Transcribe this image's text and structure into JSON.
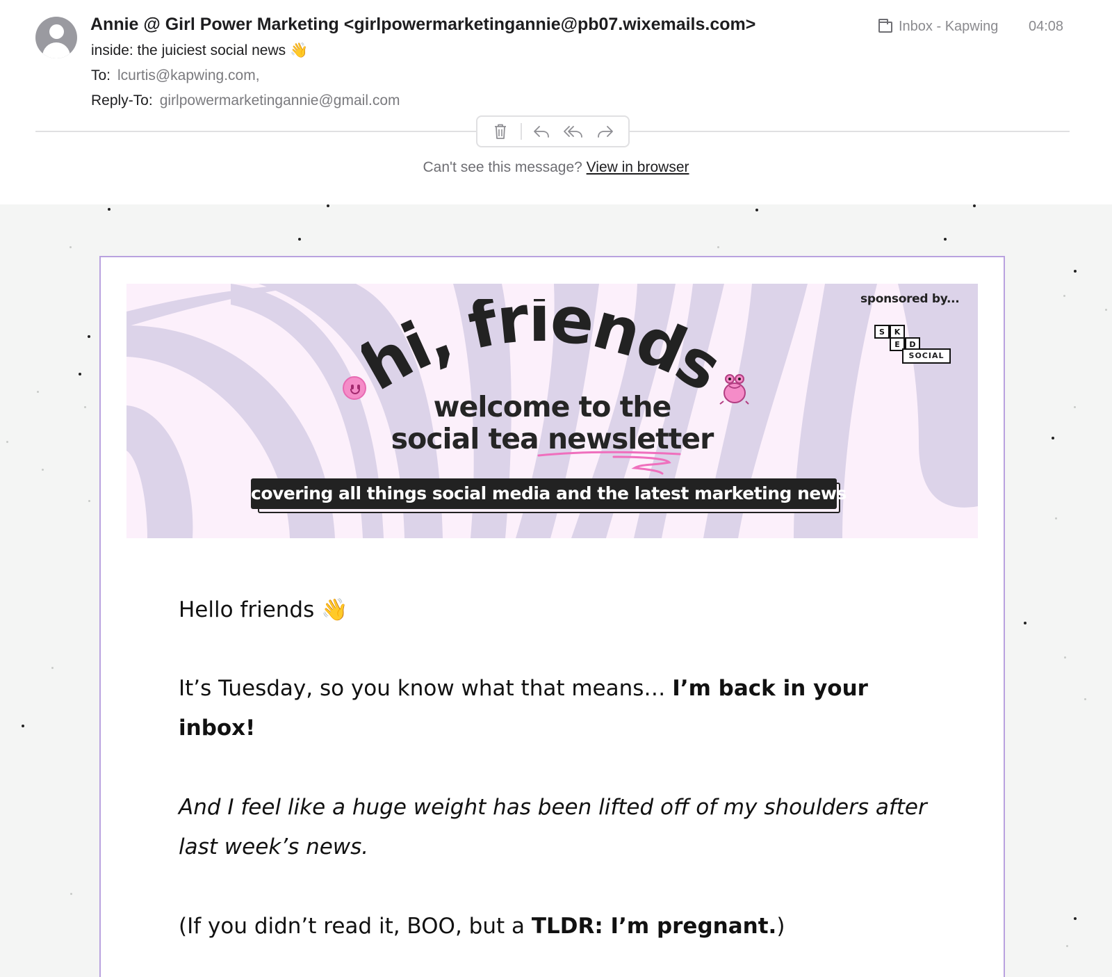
{
  "header": {
    "sender": "Annie @ Girl Power Marketing <girlpowermarketingannie@pb07.wixemails.com>",
    "subject": "inside: the juiciest social news 👋",
    "to_label": "To:",
    "to_value": "lcurtis@kapwing.com,",
    "replyto_label": "Reply-To:",
    "replyto_value": "girlpowermarketingannie@gmail.com",
    "mailbox": "Inbox - Kapwing",
    "time": "04:08"
  },
  "toolbar": {
    "icons": [
      "trash-icon",
      "reply-icon",
      "reply-all-icon",
      "forward-icon"
    ]
  },
  "preview": {
    "prompt": "Can't see this message?",
    "link": "View in browser"
  },
  "banner": {
    "headline": "hi, friends",
    "welcome_line1": "welcome to the",
    "welcome_line2_a": "social tea ",
    "welcome_line2_b": "newsletter",
    "tagline": "covering all things social media and the latest marketing news",
    "sponsored": "sponsored by...",
    "sponsor_letters": [
      "S",
      "K",
      "E",
      "D"
    ],
    "sponsor_word": "SOCIAL",
    "colors": {
      "stripe": "#dcd3e9",
      "background": "#fcf0fb",
      "accent_pink": "#f58cc8"
    }
  },
  "body": {
    "greeting": "Hello friends 👋",
    "p1_normal": "It’s Tuesday, so you know what that means… ",
    "p1_bold": "I’m back in your inbox!",
    "p2": "And I feel like a huge weight has been lifted off of my shoulders after last week’s news.",
    "p3_a": "(If you didn’t read it, BOO, but a ",
    "p3_bold": "TLDR: I’m pregnant.",
    "p3_b": ")"
  }
}
